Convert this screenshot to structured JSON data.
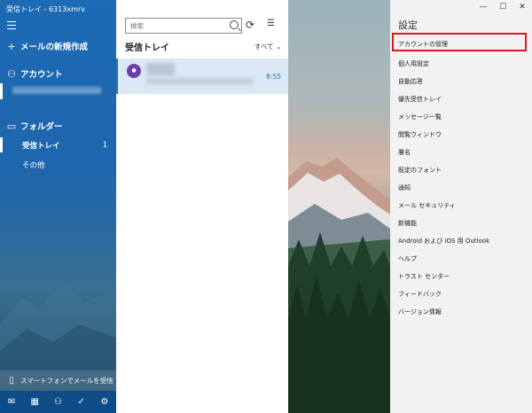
{
  "window_title": "受信トレイ - 6313xmrv",
  "nav": {
    "new_mail": "メールの新規作成",
    "account": "アカウント",
    "folders": "フォルダー",
    "inbox": "受信トレイ",
    "inbox_count": "1",
    "other": "その他",
    "phone_promo": "スマートフォンでメールを受信"
  },
  "list": {
    "search_placeholder": "検索",
    "folder_title": "受信トレイ",
    "filter": "すべて",
    "message_time": "8:55"
  },
  "settings": {
    "title": "設定",
    "items": [
      "アカウントの管理",
      "個人用設定",
      "自動応答",
      "優先受信トレイ",
      "メッセージ一覧",
      "閲覧ウィンドウ",
      "署名",
      "既定のフォント",
      "通知",
      "メール セキュリティ",
      "新機能",
      "Android および iOS 用 Outlook",
      "ヘルプ",
      "トラスト センター",
      "フィードバック",
      "バージョン情報"
    ]
  },
  "window_controls": {
    "minimize": "—",
    "maximize": "☐",
    "close": "✕"
  },
  "colors": {
    "accent": "#1e66ad",
    "highlight": "#e0161b",
    "settings_bg": "#f2f2f2"
  }
}
